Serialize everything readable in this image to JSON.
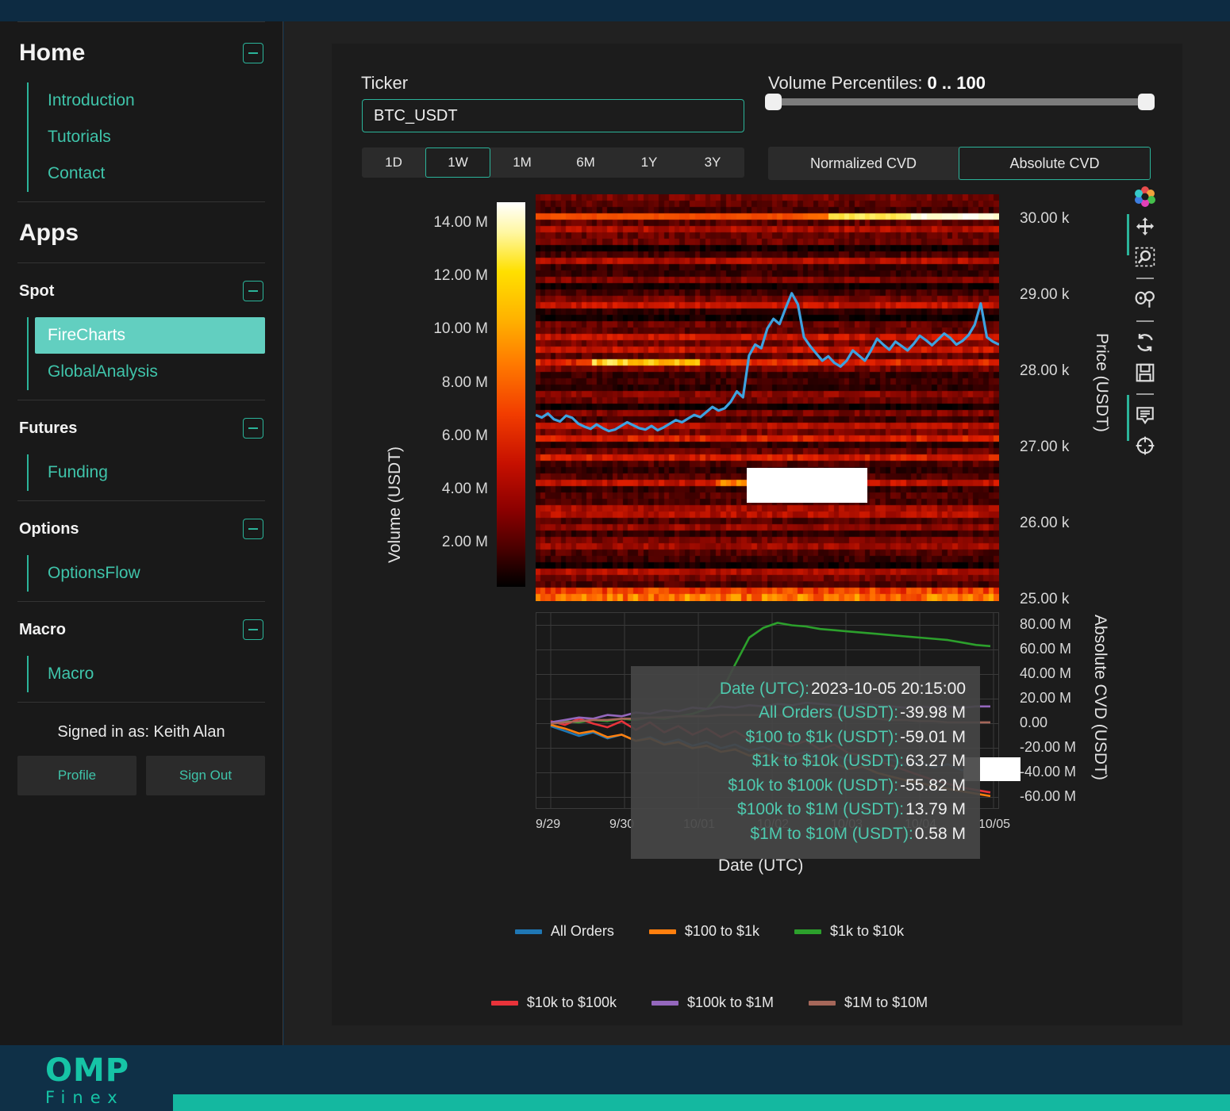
{
  "brand": {
    "logo_primary": "OMP",
    "logo_secondary": "Finex",
    "accent": "#14b8a0",
    "teal": "#2bb49a"
  },
  "sidebar": {
    "home": {
      "title": "Home",
      "collapse_icon": "minus-box-icon",
      "links": [
        "Introduction",
        "Tutorials",
        "Contact"
      ]
    },
    "apps_title": "Apps",
    "groups": [
      {
        "title": "Spot",
        "collapse_icon": "minus-box-icon",
        "links": [
          "FireCharts",
          "GlobalAnalysis"
        ],
        "active": "FireCharts"
      },
      {
        "title": "Futures",
        "collapse_icon": "minus-box-icon",
        "links": [
          "Funding"
        ],
        "active": null
      },
      {
        "title": "Options",
        "collapse_icon": "minus-box-icon",
        "links": [
          "OptionsFlow"
        ],
        "active": null
      },
      {
        "title": "Macro",
        "collapse_icon": "minus-box-icon",
        "links": [
          "Macro"
        ],
        "active": null
      }
    ],
    "signed_in_as": "Signed in as: Keith Alan",
    "profile_label": "Profile",
    "sign_out_label": "Sign Out"
  },
  "controls": {
    "ticker_label": "Ticker",
    "ticker_value": "BTC_USDT",
    "ticker_placeholder": "BTC_USDT",
    "ranges": [
      "1D",
      "1W",
      "1M",
      "6M",
      "1Y",
      "3Y"
    ],
    "range_selected": "1W",
    "volume_percentiles_label": "Volume Percentiles: ",
    "volume_percentiles_value": "0 .. 100",
    "volume_percentile_min": 0,
    "volume_percentile_max": 100,
    "cvd_modes": [
      "Normalized CVD",
      "Absolute CVD"
    ],
    "cvd_selected": "Absolute CVD"
  },
  "toolbar": {
    "icons": [
      "bokeh-logo-icon",
      "pan-icon",
      "box-zoom-icon",
      "lasso-select-icon",
      "reset-icon",
      "save-icon",
      "hover-tooltip-icon",
      "crosshair-icon"
    ]
  },
  "tooltip": {
    "rows": [
      {
        "key": "Date (UTC):",
        "value": "2023-10-05 20:15:00"
      },
      {
        "key": "All Orders (USDT):",
        "value": "-39.98 M"
      },
      {
        "key": "$100 to $1k (USDT):",
        "value": "-59.01 M"
      },
      {
        "key": "$1k to $10k (USDT):",
        "value": "63.27 M"
      },
      {
        "key": "$10k to $100k (USDT):",
        "value": "-55.82 M"
      },
      {
        "key": "$100k to $1M (USDT):",
        "value": "13.79 M"
      },
      {
        "key": "$1M to $10M (USDT):",
        "value": "0.58 M"
      }
    ]
  },
  "legend": [
    {
      "label": "All Orders",
      "color": "#1f77b4"
    },
    {
      "label": "$100 to $1k",
      "color": "#ff7f0e"
    },
    {
      "label": "$1k to $10k",
      "color": "#2ca02c"
    },
    {
      "label": "$10k to $100k",
      "color": "#e8333a"
    },
    {
      "label": "$100k to $1M",
      "color": "#9467bd"
    },
    {
      "label": "$1M to $10M",
      "color": "#a5675a"
    }
  ],
  "chart_data": [
    {
      "type": "heatmap",
      "title": "",
      "xlabel": "",
      "ylabel": "Price (USDT)",
      "colorbar_label": "Volume (USDT)",
      "colorbar_ticks": [
        "14.00 M",
        "12.00 M",
        "10.00 M",
        "8.00 M",
        "6.00 M",
        "4.00 M",
        "2.00 M"
      ],
      "colorbar_values": [
        14000000,
        12000000,
        10000000,
        8000000,
        6000000,
        4000000,
        2000000
      ],
      "colorbar_colormap": "black-red-orange-yellow-white",
      "y_ticks": [
        "30.00 k",
        "29.00 k",
        "28.00 k",
        "27.00 k",
        "26.00 k",
        "25.00 k"
      ],
      "y_values": [
        30000,
        29000,
        28000,
        27000,
        26000,
        25000
      ],
      "ylim": [
        24700,
        30250
      ],
      "grid": false,
      "overlay_series": {
        "name": "Price",
        "color": "#3da2e0"
      },
      "overlay_points": [
        27240,
        27205,
        27260,
        27180,
        27150,
        27230,
        27200,
        27120,
        27080,
        27050,
        27110,
        27060,
        27020,
        27040,
        27090,
        27140,
        27100,
        27060,
        27040,
        27090,
        27030,
        27070,
        27120,
        27170,
        27140,
        27190,
        27240,
        27210,
        27280,
        27350,
        27300,
        27330,
        27420,
        27560,
        27480,
        28050,
        28200,
        28150,
        28420,
        28550,
        28480,
        28700,
        28900,
        28750,
        28300,
        28180,
        28080,
        27980,
        28040,
        27950,
        27900,
        27980,
        28120,
        28050,
        27980,
        28120,
        28280,
        28200,
        28130,
        28240,
        28180,
        28120,
        28210,
        28320,
        28260,
        28190,
        28270,
        28350,
        28290,
        28200,
        28250,
        28330,
        28470,
        28760,
        28300,
        28240,
        28200
      ]
    },
    {
      "type": "line",
      "title": "",
      "xlabel": "Date (UTC)",
      "ylabel": "Absolute CVD (USDT)",
      "y_ticks": [
        "80.00 M",
        "60.00 M",
        "40.00 M",
        "20.00 M",
        "0.00",
        "-20.00 M",
        "-40.00 M",
        "-60.00 M"
      ],
      "y_values": [
        80000000,
        60000000,
        40000000,
        20000000,
        0,
        -20000000,
        -40000000,
        -60000000
      ],
      "ylim": [
        -70000000,
        90000000
      ],
      "x_ticks": [
        "9/29",
        "9/30",
        "10/01",
        "10/02",
        "10/03",
        "10/04",
        "10/05"
      ],
      "grid": true,
      "series": [
        {
          "name": "All Orders",
          "color": "#1f77b4",
          "values": [
            -2,
            -6,
            -10,
            -7,
            -12,
            -9,
            -14,
            -11,
            -16,
            -13,
            -18,
            -15,
            -20,
            -17,
            -22,
            -19,
            -24,
            -26,
            -23,
            -28,
            -25,
            -30,
            -27,
            -32,
            -29,
            -34,
            -31,
            -36,
            -33,
            -38,
            -35,
            -40
          ]
        },
        {
          "name": "$100 to $1k",
          "color": "#ff7f0e",
          "values": [
            -1,
            -4,
            -8,
            -6,
            -11,
            -9,
            -14,
            -12,
            -17,
            -15,
            -20,
            -18,
            -23,
            -21,
            -26,
            -24,
            -29,
            -31,
            -28,
            -34,
            -32,
            -37,
            -35,
            -40,
            -43,
            -46,
            -48,
            -51,
            -53,
            -55,
            -57,
            -59
          ]
        },
        {
          "name": "$1k to $10k",
          "color": "#2ca02c",
          "values": [
            0,
            2,
            1,
            3,
            2,
            4,
            3,
            5,
            4,
            6,
            8,
            12,
            25,
            48,
            70,
            78,
            82,
            80,
            79,
            77,
            76,
            75,
            74,
            73,
            72,
            71,
            70,
            69,
            68,
            66,
            64,
            63
          ]
        },
        {
          "name": "$10k to $100k",
          "color": "#e8333a",
          "values": [
            2,
            -1,
            4,
            0,
            -3,
            2,
            -5,
            1,
            -7,
            -2,
            -9,
            -4,
            -11,
            -6,
            -13,
            -8,
            -15,
            -18,
            -14,
            -21,
            -17,
            -24,
            -26,
            -30,
            -34,
            -38,
            -42,
            -46,
            -49,
            -52,
            -54,
            -56
          ]
        },
        {
          "name": "$100k to $1M",
          "color": "#9467bd",
          "values": [
            1,
            3,
            5,
            4,
            7,
            6,
            9,
            8,
            11,
            10,
            13,
            12,
            14,
            13,
            15,
            14,
            16,
            15,
            17,
            16,
            15,
            14,
            16,
            15,
            14,
            13,
            14,
            13,
            14,
            13,
            14,
            14
          ]
        },
        {
          "name": "$1M to $10M",
          "color": "#a5675a",
          "values": [
            0,
            1,
            2,
            3,
            3,
            4,
            4,
            5,
            5,
            6,
            6,
            6,
            7,
            7,
            7,
            7,
            7,
            6,
            6,
            6,
            5,
            5,
            4,
            4,
            3,
            3,
            2,
            2,
            1,
            1,
            1,
            1
          ]
        }
      ]
    }
  ]
}
